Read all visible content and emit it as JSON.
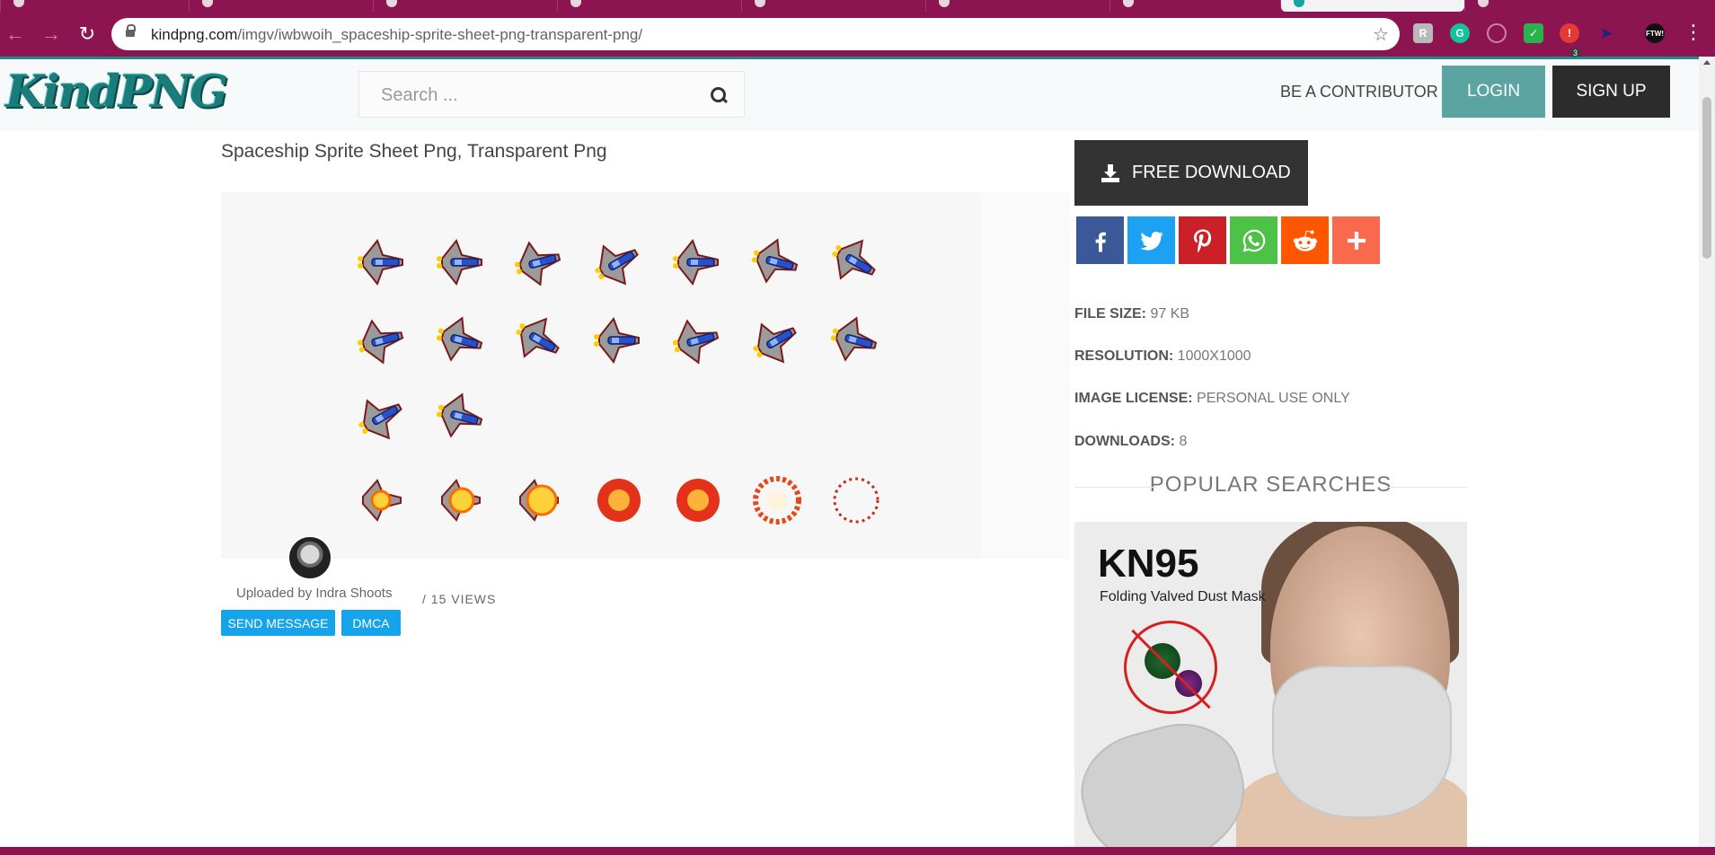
{
  "browser": {
    "url_host": "kindpng.com",
    "url_path": "/imgv/iwbwoih_spaceship-sprite-sheet-png-transparent-png/",
    "ext_badge": "3",
    "ext_ftw_label": "FTW!"
  },
  "header": {
    "logo_text": "KindPNG",
    "search_placeholder": "Search ...",
    "contributor_label": "BE A CONTRIBUTOR",
    "login_label": "LOGIN",
    "signup_label": "SIGN UP"
  },
  "main": {
    "title": "Spaceship Sprite Sheet Png, Transparent Png",
    "uploaded_by": "Uploaded by Indra Shoots",
    "views": "/ 15 VIEWS",
    "send_message_label": "SEND MESSAGE",
    "dmca_label": "DMCA"
  },
  "sidebar": {
    "download_label": "FREE DOWNLOAD",
    "share_buttons": [
      {
        "name": "facebook",
        "color": "#3b5998"
      },
      {
        "name": "twitter",
        "color": "#1da1f2"
      },
      {
        "name": "pinterest",
        "color": "#cb2027"
      },
      {
        "name": "whatsapp",
        "color": "#4dc247"
      },
      {
        "name": "reddit",
        "color": "#ff5700"
      },
      {
        "name": "more",
        "color": "#f8694d"
      }
    ],
    "file_size_label": "FILE SIZE:",
    "file_size": "97 KB",
    "resolution_label": "RESOLUTION:",
    "resolution": "1000X1000",
    "license_label": "IMAGE LICENSE:",
    "license": "PERSONAL USE ONLY",
    "downloads_label": "DOWNLOADS:",
    "downloads": "8",
    "popular_searches": "POPULAR SEARCHES",
    "ad_title": "KN95",
    "ad_subtitle": "Folding Valved Dust Mask"
  },
  "colors": {
    "brand": "#1b7d7b",
    "login": "#5ca4a2",
    "action_blue": "#15a3e9",
    "chrome": "#8b1451"
  }
}
